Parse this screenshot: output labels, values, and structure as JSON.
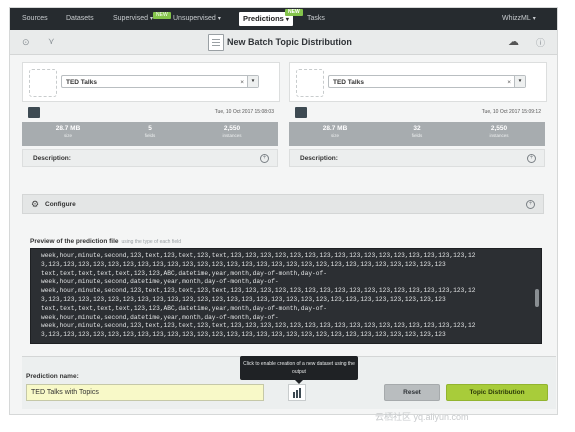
{
  "nav": {
    "items": [
      "Sources",
      "Datasets",
      "Supervised",
      "Unsupervised",
      "Predictions",
      "Tasks"
    ],
    "badge_supervised": "NEW",
    "badge_predictions": "NEW",
    "user": "WhizzML"
  },
  "header": {
    "title": "New Batch Topic Distribution"
  },
  "left_panel": {
    "select_value": "TED Talks",
    "date": "Tue, 10 Oct 2017 15:08:03",
    "stats": [
      {
        "value": "28.7 MB",
        "label": "size"
      },
      {
        "value": "5",
        "label": "fields"
      },
      {
        "value": "2,550",
        "label": "instances"
      }
    ],
    "description_label": "Description:"
  },
  "right_panel": {
    "select_value": "TED Talks",
    "date": "Tue, 10 Oct 2017 15:09:12",
    "stats": [
      {
        "value": "28.7 MB",
        "label": "size"
      },
      {
        "value": "32",
        "label": "fields"
      },
      {
        "value": "2,550",
        "label": "instances"
      }
    ],
    "description_label": "Description:"
  },
  "configure": {
    "label": "Configure"
  },
  "preview": {
    "label": "Preview of the prediction file",
    "hint": "using the type of each field",
    "lines": [
      "week,hour,minute,second,123,text,123,text,123,text,123,123,123,123,123,123,123,123,123,123,123,123,123,123,123,123,12",
      "3,123,123,123,123,123,123,123,123,123,123,123,123,123,123,123,123,123,123,123,123,123,123,123,123,123,123,123",
      "text,text,text,text,text,123,123,ABC,datetime,year,month,day-of-month,day-of-",
      "week,hour,minute,second,datetime,year,month,day-of-month,day-of-",
      "week,hour,minute,second,123,text,123,text,123,text,123,123,123,123,123,123,123,123,123,123,123,123,123,123,123,123,12",
      "3,123,123,123,123,123,123,123,123,123,123,123,123,123,123,123,123,123,123,123,123,123,123,123,123,123,123,123",
      "text,text,text,text,text,123,123,ABC,datetime,year,month,day-of-month,day-of-",
      "week,hour,minute,second,datetime,year,month,day-of-month,day-of-",
      "week,hour,minute,second,123,text,123,text,123,text,123,123,123,123,123,123,123,123,123,123,123,123,123,123,123,123,12",
      "3,123,123,123,123,123,123,123,123,123,123,123,123,123,123,123,123,123,123,123,123,123,123,123,123,123,123,123"
    ]
  },
  "bottom": {
    "prediction_name_label": "Prediction name:",
    "prediction_name_value": "TED Talks with Topics",
    "tooltip": "Click to enable creation of a new dataset using the output",
    "reset_label": "Reset",
    "submit_label": "Topic Distribution"
  },
  "watermark": "云栖社区 yq.aliyun.com",
  "colors": {
    "nav_bg": "#262b2f",
    "accent_green": "#a8cc3a",
    "badge_green": "#84c44b",
    "code_bg": "#2c2f33"
  }
}
